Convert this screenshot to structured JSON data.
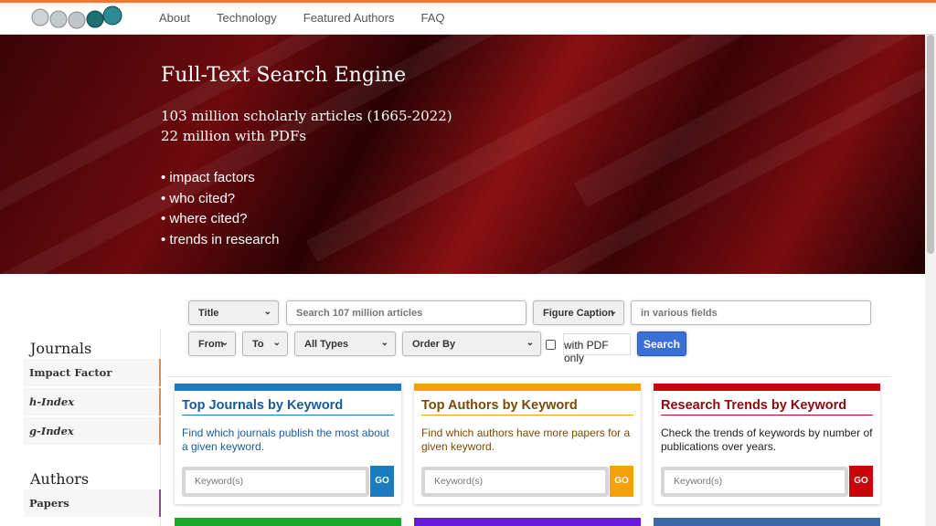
{
  "nav": {
    "items": [
      "About",
      "Technology",
      "Featured Authors",
      "FAQ"
    ]
  },
  "hero": {
    "title": "Full-Text Search Engine",
    "stat1": "103 million scholarly articles (1665-2022)",
    "stat2": "22 million with PDFs",
    "bullets": [
      "• impact factors",
      "• who cited?",
      "• where cited?",
      "• trends in research"
    ]
  },
  "search": {
    "field_select": "Title",
    "query_placeholder": "Search 107 million articles",
    "figure_select": "Figure Caption",
    "various_placeholder": "in various fields",
    "from": "From",
    "to": "To",
    "types": "All Types",
    "order": "Order By",
    "pdf_only": "with PDF only",
    "button": "Search"
  },
  "sidebar": {
    "journals_heading": "Journals",
    "journals": [
      "Impact Factor",
      "h-Index",
      "g-Index"
    ],
    "authors_heading": "Authors",
    "authors": [
      "Papers"
    ]
  },
  "cards": [
    {
      "title": "Top Journals by Keyword",
      "desc": "Find which journals publish the most about a given keyword.",
      "placeholder": "Keyword(s)",
      "go": "GO",
      "color": "#1a7bbf",
      "title_color": "#1a5a9a"
    },
    {
      "title": "Top Authors by Keyword",
      "desc": "Find which authors have more papers for a given keyword.",
      "placeholder": "Keyword(s)",
      "go": "GO",
      "color": "#f5a10a",
      "title_color": "#7a4a08"
    },
    {
      "title": "Research Trends by Keyword",
      "desc": "Check the trends of keywords by number of publications over years.",
      "placeholder": "Keyword(s)",
      "go": "GO",
      "color": "#c7060c",
      "title_color": "#8a0a0e"
    }
  ],
  "colors": {
    "accent": "#f07a2a",
    "search_button": "#3a6fd8"
  }
}
